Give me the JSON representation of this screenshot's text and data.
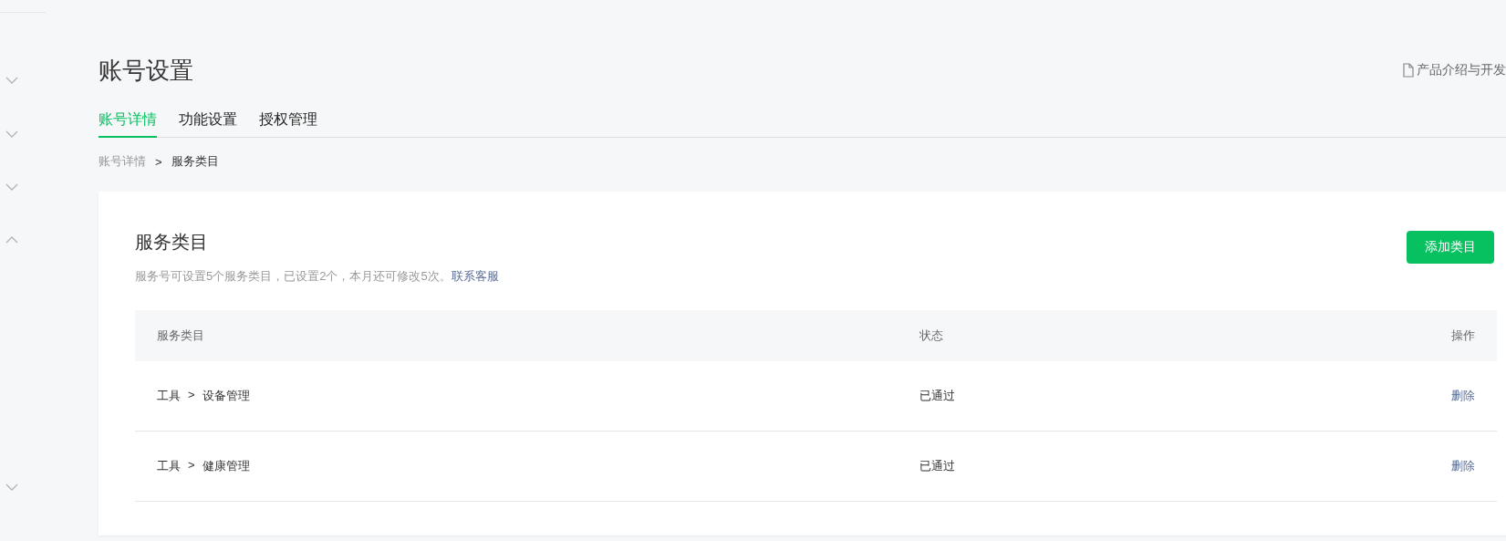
{
  "sidebar": {
    "sections": [
      {
        "expanded": false
      },
      {
        "expanded": false
      },
      {
        "expanded": false
      },
      {
        "expanded": true
      },
      {
        "expanded": false
      }
    ]
  },
  "header": {
    "title": "账号设置",
    "doc_link": "产品介绍与开发"
  },
  "tabs": [
    {
      "label": "账号详情",
      "selected": true
    },
    {
      "label": "功能设置",
      "selected": false
    },
    {
      "label": "授权管理",
      "selected": false
    }
  ],
  "breadcrumb": {
    "items": [
      "账号详情",
      "服务类目"
    ],
    "separator": ">"
  },
  "card": {
    "title": "服务类目",
    "description": "服务号可设置5个服务类目，已设置2个，本月还可修改5次。",
    "contact_link": "联系客服",
    "add_button": "添加类目",
    "table": {
      "columns": [
        "服务类目",
        "状态",
        "操作"
      ],
      "rows": [
        {
          "category": "工具",
          "separator": ">",
          "subcategory": "设备管理",
          "status": "已通过",
          "action": "删除"
        },
        {
          "category": "工具",
          "separator": ">",
          "subcategory": "健康管理",
          "status": "已通过",
          "action": "删除"
        }
      ]
    }
  }
}
